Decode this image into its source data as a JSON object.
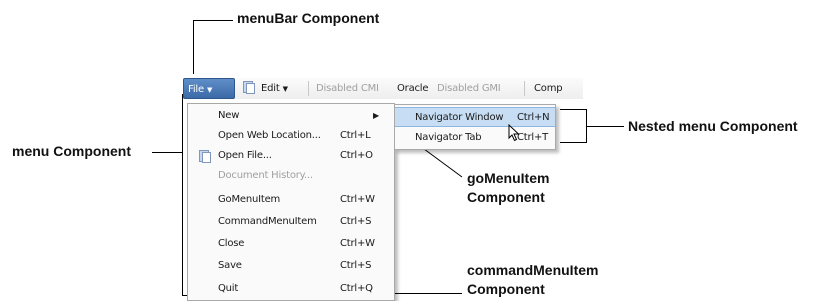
{
  "callouts": {
    "menubar": "menuBar Component",
    "menu": "menu Component",
    "nested": "Nested menu Component",
    "gomenu_line1": "goMenuItem",
    "gomenu_line2": "Component",
    "command_line1": "commandMenuItem",
    "command_line2": "Component"
  },
  "menubar": {
    "file": "File",
    "edit": "Edit",
    "disabled_cmi": "Disabled CMI",
    "oracle": "Oracle",
    "disabled_gmi": "Disabled GMI",
    "comp": "Comp"
  },
  "menu": {
    "items": [
      {
        "label": "New",
        "shortcut": "",
        "submenu": true
      },
      {
        "label": "Open Web Location...",
        "shortcut": "Ctrl+L"
      },
      {
        "label": "Open File...",
        "shortcut": "Ctrl+O",
        "icon": "document-icon"
      },
      {
        "label": "Document History...",
        "shortcut": "",
        "disabled": true
      },
      {
        "label": "GoMenuItem",
        "shortcut": "Ctrl+W"
      },
      {
        "label": "CommandMenuItem",
        "shortcut": "Ctrl+S"
      },
      {
        "label": "Close",
        "shortcut": "Ctrl+W"
      },
      {
        "label": "Save",
        "shortcut": "Ctrl+S"
      },
      {
        "label": "Quit",
        "shortcut": "Ctrl+Q"
      }
    ]
  },
  "submenu": {
    "items": [
      {
        "label": "Navigator Window",
        "shortcut": "Ctrl+N",
        "highlighted": true
      },
      {
        "label": "Navigator Tab",
        "shortcut": "Ctrl+T"
      }
    ]
  },
  "colors": {
    "file_button": "#3c6aa8",
    "highlight": "#c6ddf3",
    "disabled_text": "#a0a0a0"
  }
}
